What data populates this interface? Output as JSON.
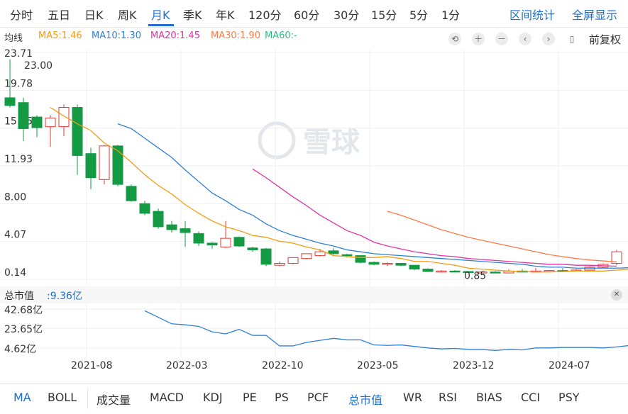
{
  "period_tabs": [
    "分时",
    "五日",
    "日K",
    "周K",
    "月K",
    "季K",
    "年K",
    "120分",
    "60分",
    "30分",
    "15分",
    "5分",
    "1分"
  ],
  "active_period": "月K",
  "top_links": [
    "区间统计",
    "全屏显示"
  ],
  "ma_legend": {
    "label": "均线",
    "items": [
      {
        "text": "MA5:1.46",
        "color": "#f39c12"
      },
      {
        "text": "MA10:1.30",
        "color": "#2f7fd6"
      },
      {
        "text": "MA20:1.45",
        "color": "#e0339f"
      },
      {
        "text": "MA30:1.90",
        "color": "#ff7a45"
      },
      {
        "text": "MA60:-",
        "color": "#2ebd85"
      }
    ]
  },
  "controls": {
    "icons": [
      "undo-icon",
      "zoom-in-icon",
      "zoom-out-icon",
      "chevron-left-icon",
      "chevron-right-icon",
      "candle-icon"
    ],
    "adjust_label": "前复权"
  },
  "watermark": "雪球",
  "colors": {
    "up": "#e53935",
    "down": "#139a43",
    "grid": "#efefef"
  },
  "chart_data": [
    {
      "type": "candlestick",
      "y_ticks": [
        "23.71",
        "19.78",
        "15.85",
        "11.93",
        "8.00",
        "4.07",
        "0.14"
      ],
      "ylim": [
        0.14,
        23.71
      ],
      "max_label": "23.00",
      "min_label": "0.85",
      "x_ticks": [
        "2021-08",
        "2022-03",
        "2022-10",
        "2023-05",
        "2023-12",
        "2024-07"
      ],
      "candles": [
        {
          "o": 19.0,
          "h": 23.0,
          "l": 18.0,
          "c": 18.2
        },
        {
          "o": 18.5,
          "h": 19.0,
          "l": 14.5,
          "c": 15.8
        },
        {
          "o": 17.0,
          "h": 17.2,
          "l": 14.9,
          "c": 15.9
        },
        {
          "o": 16.0,
          "h": 17.2,
          "l": 13.9,
          "c": 16.9
        },
        {
          "o": 16.0,
          "h": 18.3,
          "l": 15.0,
          "c": 18.0
        },
        {
          "o": 18.0,
          "h": 18.3,
          "l": 11.0,
          "c": 13.0
        },
        {
          "o": 13.2,
          "h": 13.8,
          "l": 9.5,
          "c": 10.7
        },
        {
          "o": 10.5,
          "h": 14.1,
          "l": 10.0,
          "c": 14.0
        },
        {
          "o": 14.0,
          "h": 14.1,
          "l": 9.8,
          "c": 10.0
        },
        {
          "o": 9.8,
          "h": 10.0,
          "l": 8.2,
          "c": 8.3
        },
        {
          "o": 8.0,
          "h": 8.3,
          "l": 6.8,
          "c": 7.0
        },
        {
          "o": 7.2,
          "h": 7.5,
          "l": 5.4,
          "c": 5.6
        },
        {
          "o": 5.8,
          "h": 6.2,
          "l": 5.0,
          "c": 5.3
        },
        {
          "o": 5.4,
          "h": 6.2,
          "l": 3.5,
          "c": 5.0
        },
        {
          "o": 4.9,
          "h": 5.1,
          "l": 3.6,
          "c": 3.9
        },
        {
          "o": 3.9,
          "h": 4.0,
          "l": 3.3,
          "c": 3.7
        },
        {
          "o": 3.5,
          "h": 6.2,
          "l": 3.4,
          "c": 4.4
        },
        {
          "o": 4.5,
          "h": 4.6,
          "l": 3.5,
          "c": 3.6
        },
        {
          "o": 3.4,
          "h": 3.5,
          "l": 3.0,
          "c": 3.2
        },
        {
          "o": 3.3,
          "h": 3.4,
          "l": 1.5,
          "c": 1.7
        },
        {
          "o": 1.6,
          "h": 2.0,
          "l": 1.5,
          "c": 1.8
        },
        {
          "o": 1.8,
          "h": 2.4,
          "l": 1.7,
          "c": 2.4
        },
        {
          "o": 2.3,
          "h": 2.8,
          "l": 2.2,
          "c": 2.8
        },
        {
          "o": 2.6,
          "h": 3.3,
          "l": 2.5,
          "c": 3.0
        },
        {
          "o": 3.1,
          "h": 3.4,
          "l": 2.7,
          "c": 2.8
        },
        {
          "o": 2.7,
          "h": 2.8,
          "l": 2.4,
          "c": 2.6
        },
        {
          "o": 2.6,
          "h": 2.6,
          "l": 1.8,
          "c": 1.9
        },
        {
          "o": 1.9,
          "h": 2.0,
          "l": 1.6,
          "c": 1.7
        },
        {
          "o": 1.7,
          "h": 1.9,
          "l": 1.5,
          "c": 1.8
        },
        {
          "o": 1.8,
          "h": 1.8,
          "l": 1.5,
          "c": 1.6
        },
        {
          "o": 1.6,
          "h": 1.6,
          "l": 1.1,
          "c": 1.2
        },
        {
          "o": 1.2,
          "h": 1.3,
          "l": 0.9,
          "c": 0.95
        },
        {
          "o": 0.95,
          "h": 1.1,
          "l": 0.85,
          "c": 1.0
        },
        {
          "o": 1.0,
          "h": 1.1,
          "l": 0.9,
          "c": 0.95
        },
        {
          "o": 0.95,
          "h": 1.0,
          "l": 0.85,
          "c": 0.9
        },
        {
          "o": 0.9,
          "h": 1.0,
          "l": 0.85,
          "c": 0.9
        },
        {
          "o": 0.9,
          "h": 1.0,
          "l": 0.8,
          "c": 0.8
        },
        {
          "o": 0.8,
          "h": 1.2,
          "l": 0.8,
          "c": 1.0
        },
        {
          "o": 1.0,
          "h": 1.2,
          "l": 0.9,
          "c": 0.95
        },
        {
          "o": 0.95,
          "h": 1.3,
          "l": 0.9,
          "c": 1.0
        },
        {
          "o": 1.0,
          "h": 1.1,
          "l": 0.9,
          "c": 1.05
        },
        {
          "o": 1.05,
          "h": 1.3,
          "l": 0.9,
          "c": 1.0
        },
        {
          "o": 1.0,
          "h": 1.2,
          "l": 0.95,
          "c": 1.1
        },
        {
          "o": 1.1,
          "h": 1.5,
          "l": 1.0,
          "c": 1.4
        },
        {
          "o": 1.4,
          "h": 1.8,
          "l": 1.3,
          "c": 1.7
        },
        {
          "o": 1.8,
          "h": 3.2,
          "l": 1.6,
          "c": 3.0
        }
      ],
      "ma_lines": [
        {
          "name": "MA5",
          "color": "#f39c12",
          "start": 3,
          "values": [
            18.0,
            17.1,
            16.3,
            15.6,
            14.3,
            13.5,
            12.3,
            11.0,
            9.9,
            9.0,
            7.9,
            7.0,
            6.2,
            5.6,
            5.2,
            4.7,
            4.5,
            4.1,
            3.9,
            3.5,
            3.2,
            2.6,
            2.5,
            2.4,
            2.4,
            2.5,
            2.3,
            2.0,
            2.0,
            1.8,
            1.6,
            1.3,
            1.2,
            1.1,
            1.0,
            0.95,
            0.9,
            0.9,
            0.95,
            1.0,
            1.0,
            1.0,
            1.1,
            1.2,
            1.5
          ]
        },
        {
          "name": "MA10",
          "color": "#2f7fd6",
          "start": 8,
          "values": [
            16.3,
            15.8,
            14.8,
            13.8,
            12.8,
            11.5,
            10.3,
            9.1,
            8.3,
            7.4,
            6.8,
            5.9,
            5.2,
            4.7,
            4.3,
            3.9,
            3.6,
            3.2,
            3.0,
            2.8,
            2.7,
            2.6,
            2.5,
            2.4,
            2.3,
            2.2,
            2.1,
            2.0,
            1.9,
            1.8,
            1.7,
            1.5,
            1.4,
            1.4,
            1.3,
            1.3,
            1.3,
            1.3,
            1.35
          ]
        },
        {
          "name": "MA20",
          "color": "#e0339f",
          "start": 18,
          "values": [
            11.6,
            10.7,
            9.7,
            8.7,
            7.8,
            6.8,
            6.0,
            5.2,
            4.7,
            4.0,
            3.6,
            3.3,
            3.0,
            2.8,
            2.6,
            2.5,
            2.3,
            2.2,
            2.1,
            2.0,
            1.9,
            1.8,
            1.7,
            1.7,
            1.6,
            1.6,
            1.55,
            1.5
          ]
        },
        {
          "name": "MA30",
          "color": "#ff7a45",
          "start": 28,
          "values": [
            7.2,
            6.8,
            6.3,
            5.8,
            5.3,
            4.9,
            4.5,
            4.2,
            3.9,
            3.6,
            3.3,
            3.0,
            2.7,
            2.5,
            2.3,
            2.15,
            2.05,
            1.95
          ]
        }
      ]
    },
    {
      "type": "line",
      "title": "总市值",
      "value_label": ":9.36亿",
      "y_ticks": [
        "42.68亿",
        "23.65亿",
        "4.62亿"
      ],
      "ylim": [
        0,
        48
      ],
      "series": [
        {
          "color": "#2f7fd6",
          "start": 10,
          "values": [
            43.5,
            37.0,
            30.5,
            29.5,
            28.0,
            22.5,
            20.5,
            25.0,
            19.0,
            19.0,
            8.5,
            8.5,
            12.0,
            14.0,
            16.0,
            14.5,
            14.5,
            9.5,
            9.0,
            9.5,
            8.0,
            6.5,
            5.5,
            6.0,
            5.0,
            5.0,
            4.0,
            5.0,
            4.5,
            6.5,
            6.5,
            7.0,
            7.0,
            7.0,
            6.5,
            7.5,
            9.0,
            9.8
          ]
        }
      ]
    }
  ],
  "indicator_tabs": [
    "MA",
    "BOLL",
    "成交量",
    "MACD",
    "KDJ",
    "PE",
    "PS",
    "PCF",
    "总市值",
    "WR",
    "RSI",
    "BIAS",
    "CCI",
    "PSY"
  ],
  "active_indicators": [
    "MA",
    "总市值"
  ]
}
